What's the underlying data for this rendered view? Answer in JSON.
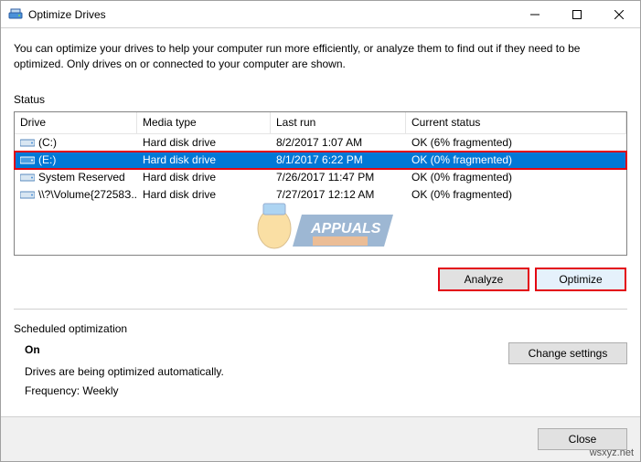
{
  "window": {
    "title": "Optimize Drives"
  },
  "description": "You can optimize your drives to help your computer run more efficiently, or analyze them to find out if they need to be optimized. Only drives on or connected to your computer are shown.",
  "status_label": "Status",
  "columns": {
    "drive": "Drive",
    "media": "Media type",
    "last": "Last run",
    "current": "Current status"
  },
  "drives": [
    {
      "name": "(C:)",
      "media": "Hard disk drive",
      "last": "8/2/2017 1:07 AM",
      "status": "OK (6% fragmented)"
    },
    {
      "name": "(E:)",
      "media": "Hard disk drive",
      "last": "8/1/2017 6:22 PM",
      "status": "OK (0% fragmented)"
    },
    {
      "name": "System Reserved",
      "media": "Hard disk drive",
      "last": "7/26/2017 11:47 PM",
      "status": "OK (0% fragmented)"
    },
    {
      "name": "\\\\?\\Volume{27258З...",
      "media": "Hard disk drive",
      "last": "7/27/2017 12:12 AM",
      "status": "OK (0% fragmented)"
    }
  ],
  "buttons": {
    "analyze": "Analyze",
    "optimize": "Optimize",
    "change_settings": "Change settings",
    "close": "Close"
  },
  "scheduled": {
    "label": "Scheduled optimization",
    "on": "On",
    "line1": "Drives are being optimized automatically.",
    "line2": "Frequency: Weekly"
  },
  "watermark": "wsxyz.net"
}
